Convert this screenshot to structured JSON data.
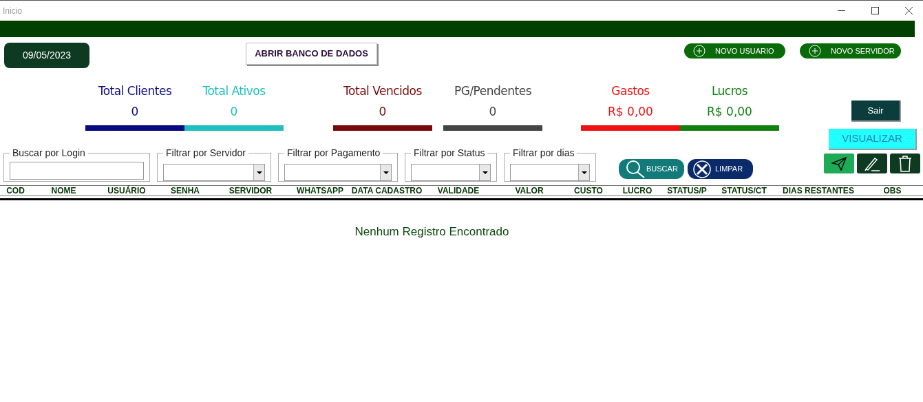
{
  "window": {
    "title": "Inicio"
  },
  "date": "09/05/2023",
  "open_db_button": "ABRIR BANCO DE DADOS",
  "new_buttons": [
    "NOVO USUARIO",
    "NOVO SERVIDOR"
  ],
  "stats": [
    {
      "label": "Total Clientes",
      "value": "0",
      "color": "#0a0a80"
    },
    {
      "label": "Total Ativos",
      "value": "0",
      "color": "#1fbfbf"
    },
    {
      "label": "Total Vencidos",
      "value": "0",
      "color": "#7a0a0a"
    },
    {
      "label": "PG/Pendentes",
      "value": "0",
      "color": "#444444"
    },
    {
      "label": "Gastos",
      "value": "R$ 0,00",
      "color": "#ee1111"
    },
    {
      "label": "Lucros",
      "value": "R$ 0,00",
      "color": "#118011"
    }
  ],
  "exit_button": "Sair",
  "view_button": "VISUALIZAR",
  "filters": [
    {
      "kind": "text",
      "label": "Buscar por Login"
    },
    {
      "kind": "dropdown",
      "label": "Filtrar por Servidor"
    },
    {
      "kind": "dropdown",
      "label": "Filtrar por Pagamento"
    },
    {
      "kind": "dropdown",
      "label": "Filtrar por Status"
    },
    {
      "kind": "dropdown",
      "label": "Filtrar por dias"
    }
  ],
  "search_button": "BUSCAR",
  "clear_button": "LIMPAR",
  "table": {
    "columns": [
      "COD",
      "NOME",
      "USUÁRIO",
      "SENHA",
      "SERVIDOR",
      "WHATSAPP",
      "DATA CADASTRO",
      "VALIDADE",
      "VALOR",
      "CUSTO",
      "LUCRO",
      "STATUS/P",
      "STATUS/CT",
      "DIAS RESTANTES",
      "OBS"
    ],
    "empty_message": "Nenhum Registro Encontrado"
  }
}
